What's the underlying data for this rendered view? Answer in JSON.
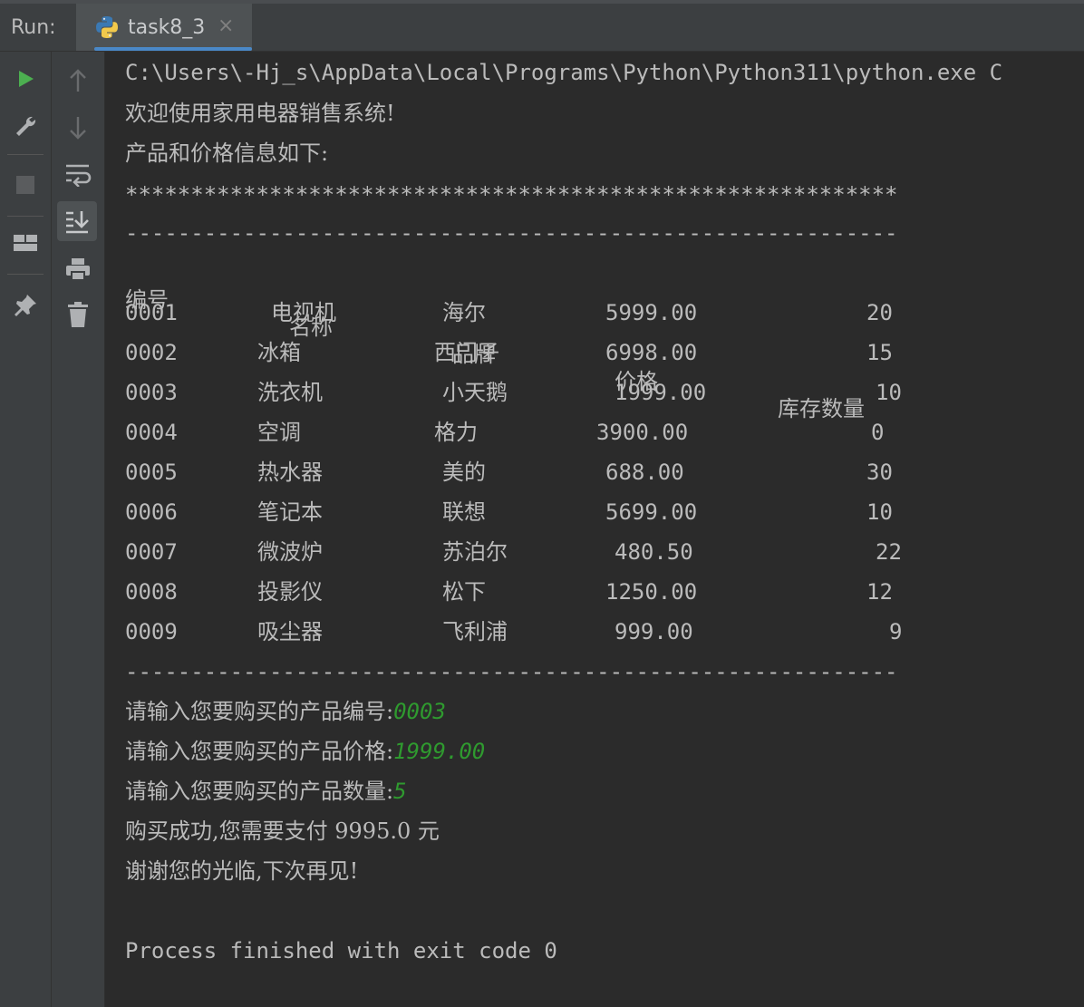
{
  "toolbar": {
    "run_label": "Run:",
    "tab_title": "task8_3",
    "tab_icon": "python-icon",
    "close_icon": "close-icon"
  },
  "left_gutter": [
    "rerun-play-icon",
    "wrench-settings-icon",
    "stop-icon",
    "layout-icon",
    "pin-icon"
  ],
  "right_gutter": [
    "arrow-up-icon",
    "arrow-down-icon",
    "soft-wrap-icon",
    "scroll-to-end-icon",
    "print-icon",
    "trash-icon"
  ],
  "colors": {
    "accent": "#4a88c7",
    "play": "#4caf50",
    "input": "#2f9a2f",
    "text": "#bbbbbb",
    "bg": "#2b2b2b"
  },
  "console": {
    "command": "C:\\Users\\-Hj_s\\AppData\\Local\\Programs\\Python\\Python311\\python.exe C",
    "welcome": "欢迎使用家用电器销售系统!",
    "info": "产品和价格信息如下:",
    "stars": "***********************************************************",
    "dashes": "-----------------------------------------------------------",
    "headers": [
      "编号",
      "名称",
      "品牌",
      "价格",
      "库存数量"
    ],
    "rows": [
      [
        "0001",
        "电视机",
        "海尔",
        "5999.00",
        "20"
      ],
      [
        "0002",
        "冰箱",
        "西门子",
        "6998.00",
        "15"
      ],
      [
        "0003",
        "洗衣机",
        "小天鹅",
        "1999.00",
        "10"
      ],
      [
        "0004",
        "空调",
        "格力",
        "3900.00",
        "0"
      ],
      [
        "0005",
        "热水器",
        "美的",
        "688.00",
        "30"
      ],
      [
        "0006",
        "笔记本",
        "联想",
        "5699.00",
        "10"
      ],
      [
        "0007",
        "微波炉",
        "苏泊尔",
        "480.50",
        "22"
      ],
      [
        "0008",
        "投影仪",
        "松下",
        "1250.00",
        "12"
      ],
      [
        "0009",
        "吸尘器",
        "飞利浦",
        "999.00",
        "9"
      ]
    ],
    "prompt_id": "请输入您要购买的产品编号:",
    "input_id": "0003",
    "prompt_price": "请输入您要购买的产品价格:",
    "input_price": "1999.00",
    "prompt_qty": "请输入您要购买的产品数量:",
    "input_qty": "5",
    "success": "购买成功,您需要支付 9995.0 元",
    "thanks": "谢谢您的光临,下次再见!",
    "exit": "Process finished with exit code 0"
  }
}
